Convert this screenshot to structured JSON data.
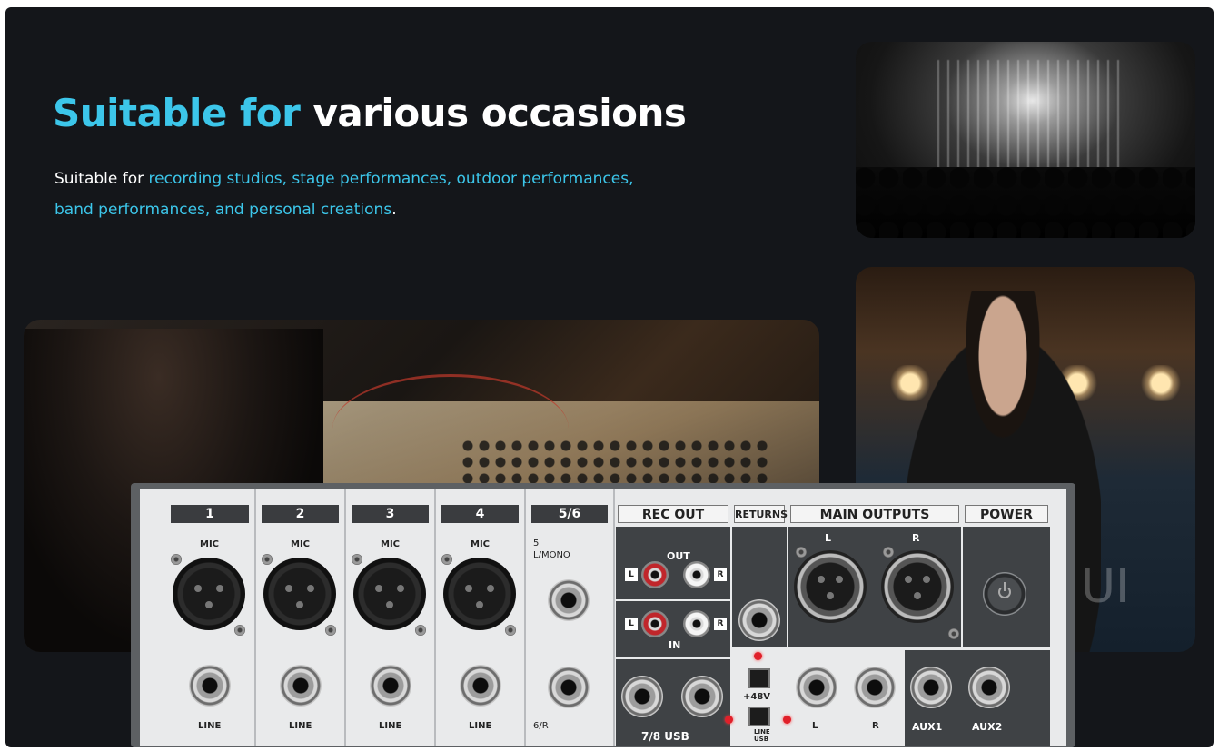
{
  "headline": {
    "accent": "Suitable for",
    "rest": " various occasions"
  },
  "description": {
    "lead": "Suitable for ",
    "highlight": "recording studios, stage performances, outdoor performances, band performances, and personal creations",
    "end": "."
  },
  "mixer": {
    "channels": [
      {
        "num": "1",
        "top": "MIC",
        "bottom": "LINE"
      },
      {
        "num": "2",
        "top": "MIC",
        "bottom": "LINE"
      },
      {
        "num": "3",
        "top": "MIC",
        "bottom": "LINE"
      },
      {
        "num": "4",
        "top": "MIC",
        "bottom": "LINE"
      }
    ],
    "ch56": {
      "num": "5/6",
      "top": "5\nL/MONO",
      "bottom": "6/R"
    },
    "rec_out": {
      "title": "REC OUT",
      "out": "OUT",
      "in": "IN",
      "l": "L",
      "r": "R",
      "usb": "7/8 USB"
    },
    "returns": {
      "title": "RETURNS"
    },
    "phantom": {
      "label": "+48V",
      "line_usb": "LINE\nUSB"
    },
    "main_outputs": {
      "title": "MAIN OUTPUTS",
      "l": "L",
      "r": "R"
    },
    "power": {
      "title": "POWER"
    },
    "aux": {
      "aux1": "AUX1",
      "aux2": "AUX2"
    }
  },
  "colors": {
    "accent": "#3cc6ea",
    "background": "#14161a",
    "panel": "#e9eaeb"
  }
}
